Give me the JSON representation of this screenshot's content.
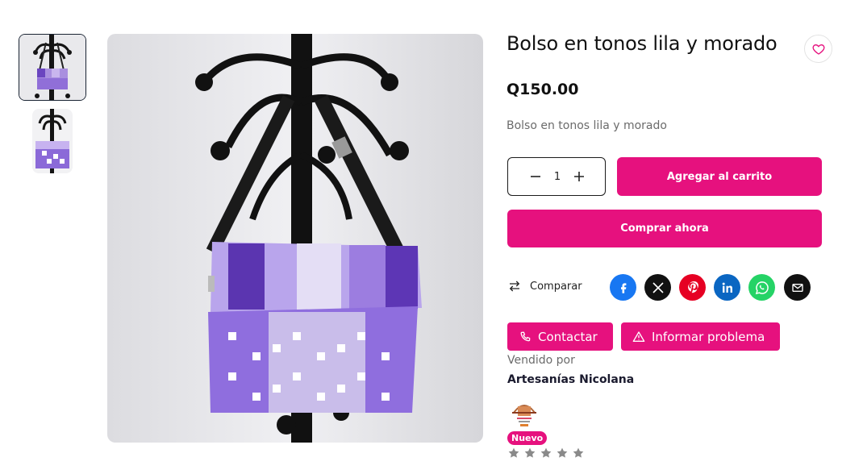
{
  "product": {
    "title": "Bolso en tonos lila y morado",
    "price": "Q150.00",
    "short_description": "Bolso en tonos lila y morado",
    "quantity": "1"
  },
  "actions": {
    "add_to_cart": "Agregar al carrito",
    "buy_now": "Comprar ahora",
    "compare": "Comparar",
    "contact": "Contactar",
    "report": "Informar problema"
  },
  "share": [
    "facebook-icon",
    "x-icon",
    "pinterest-icon",
    "linkedin-icon",
    "whatsapp-icon",
    "email-icon"
  ],
  "seller": {
    "sold_by_label": "Vendido por",
    "name": "Artesanías Nicolana",
    "badge": "Nuevo",
    "rating_stars": 0,
    "rating_max": 5
  },
  "colors": {
    "accent": "#e6117e",
    "facebook": "#1877f2",
    "x": "#111111",
    "pinterest": "#e60023",
    "linkedin": "#0a66c2",
    "whatsapp": "#25d366",
    "email": "#111111"
  }
}
